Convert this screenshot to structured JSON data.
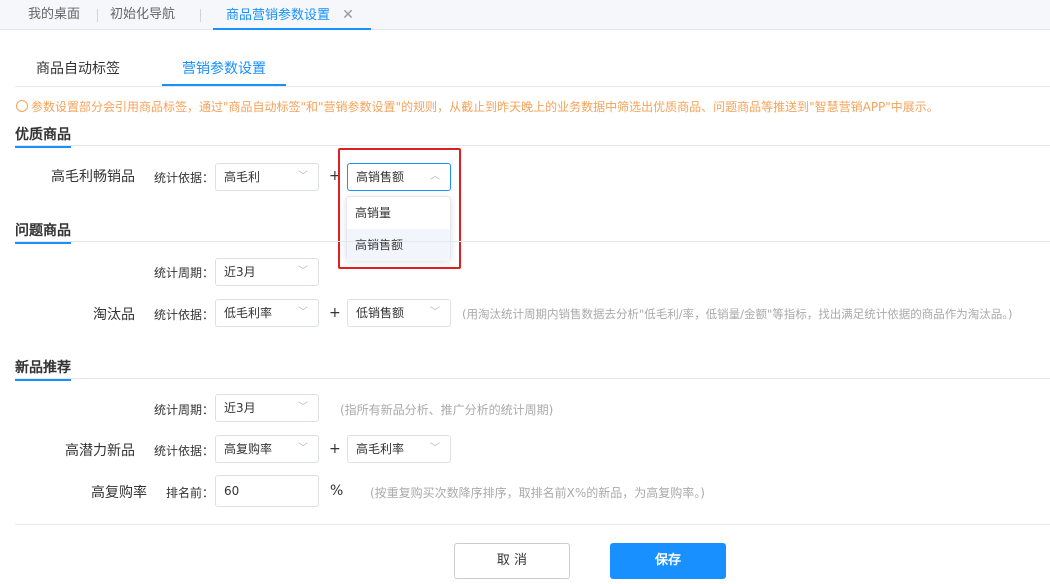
{
  "top_tabs": [
    {
      "label": "我的桌面"
    },
    {
      "label": "初始化导航"
    },
    {
      "label": "商品营销参数设置"
    }
  ],
  "sub_tabs": [
    {
      "label": "商品自动标签"
    },
    {
      "label": "营销参数设置"
    }
  ],
  "hint": "参数设置部分会引用商品标签，通过\"商品自动标签\"和\"营销参数设置\"的规则，从截止到昨天晚上的业务数据中筛选出优质商品、问题商品等推送到\"智慧营销APP\"中展示。",
  "sections": {
    "quality": {
      "title": "优质商品",
      "row_label": "高毛利畅销品",
      "basis_label": "统计依据：",
      "basis_value": "高毛利",
      "plus": "+",
      "second_value": "高销售额",
      "dropdown": [
        "高销量",
        "高销售额"
      ]
    },
    "problem": {
      "title": "问题商品",
      "period_label": "统计周期：",
      "period_value": "近3月",
      "row_label": "淘汰品",
      "basis_label": "统计依据：",
      "basis_value": "低毛利率",
      "plus": "+",
      "second_value": "低销售额",
      "note": "(用淘汰统计周期内销售数据去分析\"低毛利/率，低销量/金额\"等指标，找出满足统计依据的商品作为淘汰品。)"
    },
    "newprod": {
      "title": "新品推荐",
      "period_label": "统计周期：",
      "period_value": "近3月",
      "period_note": "(指所有新品分析、推广分析的统计周期)",
      "row_label": "高潜力新品",
      "basis_label": "统计依据：",
      "basis_value": "高复购率",
      "plus": "+",
      "second_value": "高毛利率",
      "rate_label": "高复购率",
      "rank_label": "排名前：",
      "rank_value": "60",
      "percent": "%",
      "rank_note": "(按重复购买次数降序排序，取排名前X%的新品，为高复购率。)"
    }
  },
  "buttons": {
    "cancel": "取 消",
    "save": "保存"
  },
  "colors": {
    "accent": "#1890ff",
    "hint": "#f5a35a",
    "highlight_box": "#e02020"
  }
}
